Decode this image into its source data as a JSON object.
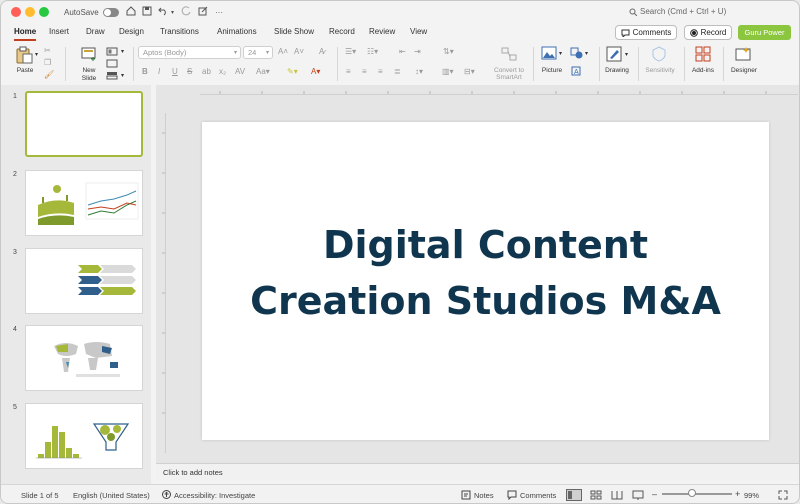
{
  "titlebar": {
    "autosave": "AutoSave",
    "search": "Search (Cmd + Ctrl + U)"
  },
  "tabs": [
    {
      "label": "Home"
    },
    {
      "label": "Insert"
    },
    {
      "label": "Draw"
    },
    {
      "label": "Design"
    },
    {
      "label": "Transitions"
    },
    {
      "label": "Animations"
    },
    {
      "label": "Slide Show"
    },
    {
      "label": "Record"
    },
    {
      "label": "Review"
    },
    {
      "label": "View"
    }
  ],
  "top_buttons": {
    "comments": "Comments",
    "record": "Record",
    "guru": "Guru Power"
  },
  "ribbon": {
    "paste": "Paste",
    "new_slide": "New Slide",
    "font_name": "Aptos (Body)",
    "font_size": "24",
    "convert": "Convert to SmartArt",
    "picture": "Picture",
    "drawing": "Drawing",
    "sensitivity": "Sensitivity",
    "addins": "Add-ins",
    "designer": "Designer"
  },
  "thumbnails": [
    {
      "n": "1"
    },
    {
      "n": "2"
    },
    {
      "n": "3"
    },
    {
      "n": "4"
    },
    {
      "n": "5"
    }
  ],
  "slide": {
    "title_line1": "Digital Content",
    "title_line2": "Creation Studios M&A"
  },
  "notes_placeholder": "Click to add notes",
  "status": {
    "slide_info": "Slide 1 of 5",
    "language": "English (United States)",
    "accessibility": "Accessibility: Investigate",
    "notes": "Notes",
    "comments": "Comments",
    "zoom": "99%"
  },
  "colors": {
    "accent": "#c43e1c",
    "title": "#10354e",
    "guru": "#8cc63f",
    "thumb_green": "#a6b83a"
  }
}
